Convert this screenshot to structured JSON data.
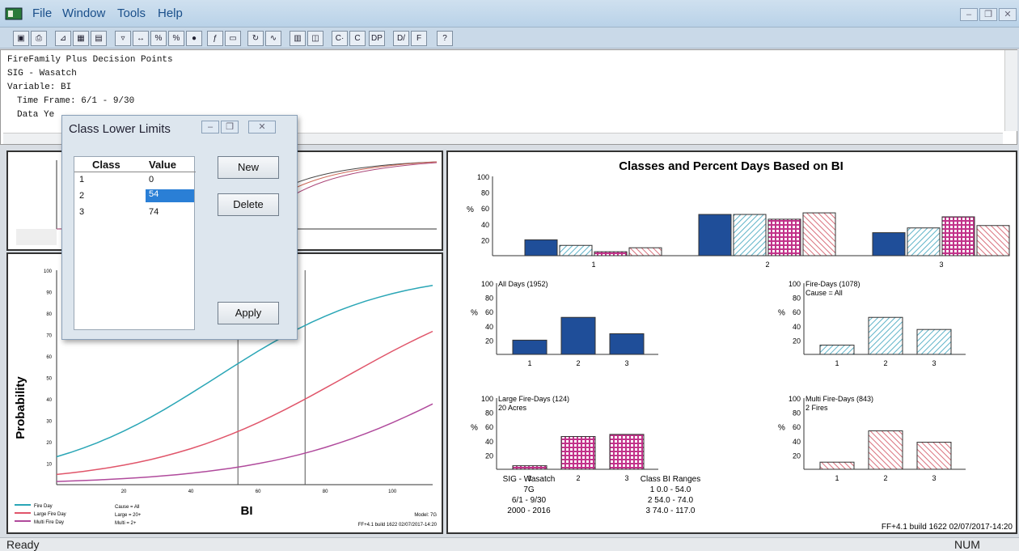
{
  "menu": {
    "file": "File",
    "window": "Window",
    "tools": "Tools",
    "help": "Help"
  },
  "toolbar": {
    "buttons": [
      "C·",
      "C",
      "DP",
      "D/",
      "F"
    ]
  },
  "report": {
    "lines": [
      "FireFamily Plus Decision Points",
      "SIG - Wasatch",
      "Variable: BI",
      "",
      "Time Frame: 6/1 - 9/30",
      "Data Ye"
    ]
  },
  "dialog": {
    "title": "Class Lower Limits",
    "col_class": "Class",
    "col_value": "Value",
    "rows": [
      {
        "class": "1",
        "value": "0"
      },
      {
        "class": "2",
        "value": "54"
      },
      {
        "class": "3",
        "value": "74"
      }
    ],
    "new_label": "New",
    "delete_label": "Delete",
    "apply_label": "Apply"
  },
  "prob_chart": {
    "ylabel": "Probability",
    "xlabel": "BI",
    "yticks": [
      "10",
      "20",
      "30",
      "40",
      "50",
      "60",
      "70",
      "80",
      "90",
      "100"
    ],
    "xticks": [
      "20",
      "40",
      "60",
      "80",
      "100"
    ],
    "legend": [
      "Fire Day",
      "Large Fire Day",
      "Multi Fire Day"
    ],
    "cause": [
      "Cause = All",
      "Large = 20+",
      "Multi = 2+"
    ],
    "model": "Model: 7G",
    "build": "FF+4.1 build 1622 02/07/2017-14:20",
    "colors": {
      "fire": "#2aa6b6",
      "large": "#e0556a",
      "multi": "#b04a9c"
    }
  },
  "chart_data": [
    {
      "type": "bar",
      "title": "Classes and Percent Days Based on BI",
      "ylabel": "%",
      "ylim": [
        0,
        100
      ],
      "categories": [
        "1",
        "2",
        "3"
      ],
      "series": [
        {
          "name": "All Days (1952)",
          "values": [
            20,
            52,
            29
          ]
        },
        {
          "name": "Fire-Days (1078)",
          "values": [
            13,
            52,
            35
          ]
        },
        {
          "name": "Large Fire-Days (124)",
          "values": [
            5,
            46,
            49
          ]
        },
        {
          "name": "Multi Fire-Days (843)",
          "values": [
            10,
            54,
            38
          ]
        }
      ],
      "colors": [
        "#1f4e99",
        "#5fb3c8",
        "#c2338a",
        "#d9707c"
      ]
    },
    {
      "type": "bar",
      "title": "All Days (1952)",
      "ylabel": "%",
      "ylim": [
        0,
        100
      ],
      "categories": [
        "1",
        "2",
        "3"
      ],
      "values": [
        20,
        52,
        29
      ]
    },
    {
      "type": "bar",
      "title": "Fire-Days (1078)",
      "subtitle": "Cause = All",
      "ylabel": "%",
      "ylim": [
        0,
        100
      ],
      "categories": [
        "1",
        "2",
        "3"
      ],
      "values": [
        13,
        52,
        35
      ]
    },
    {
      "type": "bar",
      "title": "Large Fire-Days (124)",
      "subtitle": "20 Acres",
      "ylabel": "%",
      "ylim": [
        0,
        100
      ],
      "categories": [
        "1",
        "2",
        "3"
      ],
      "values": [
        5,
        46,
        49
      ]
    },
    {
      "type": "bar",
      "title": "Multi Fire-Days (843)",
      "subtitle": "2 Fires",
      "ylabel": "%",
      "ylim": [
        0,
        100
      ],
      "categories": [
        "1",
        "2",
        "3"
      ],
      "values": [
        10,
        54,
        38
      ]
    }
  ],
  "right_footer": {
    "station": [
      "SIG - Wasatch",
      "7G",
      "6/1 - 9/30",
      "2000 - 2016"
    ],
    "ranges_title": "Class BI Ranges",
    "ranges": [
      "1  0.0 - 54.0",
      "2  54.0 - 74.0",
      "3  74.0 - 117.0"
    ],
    "build": "FF+4.1 build 1622 02/07/2017-14:20"
  },
  "status": {
    "ready": "Ready",
    "num": "NUM"
  }
}
